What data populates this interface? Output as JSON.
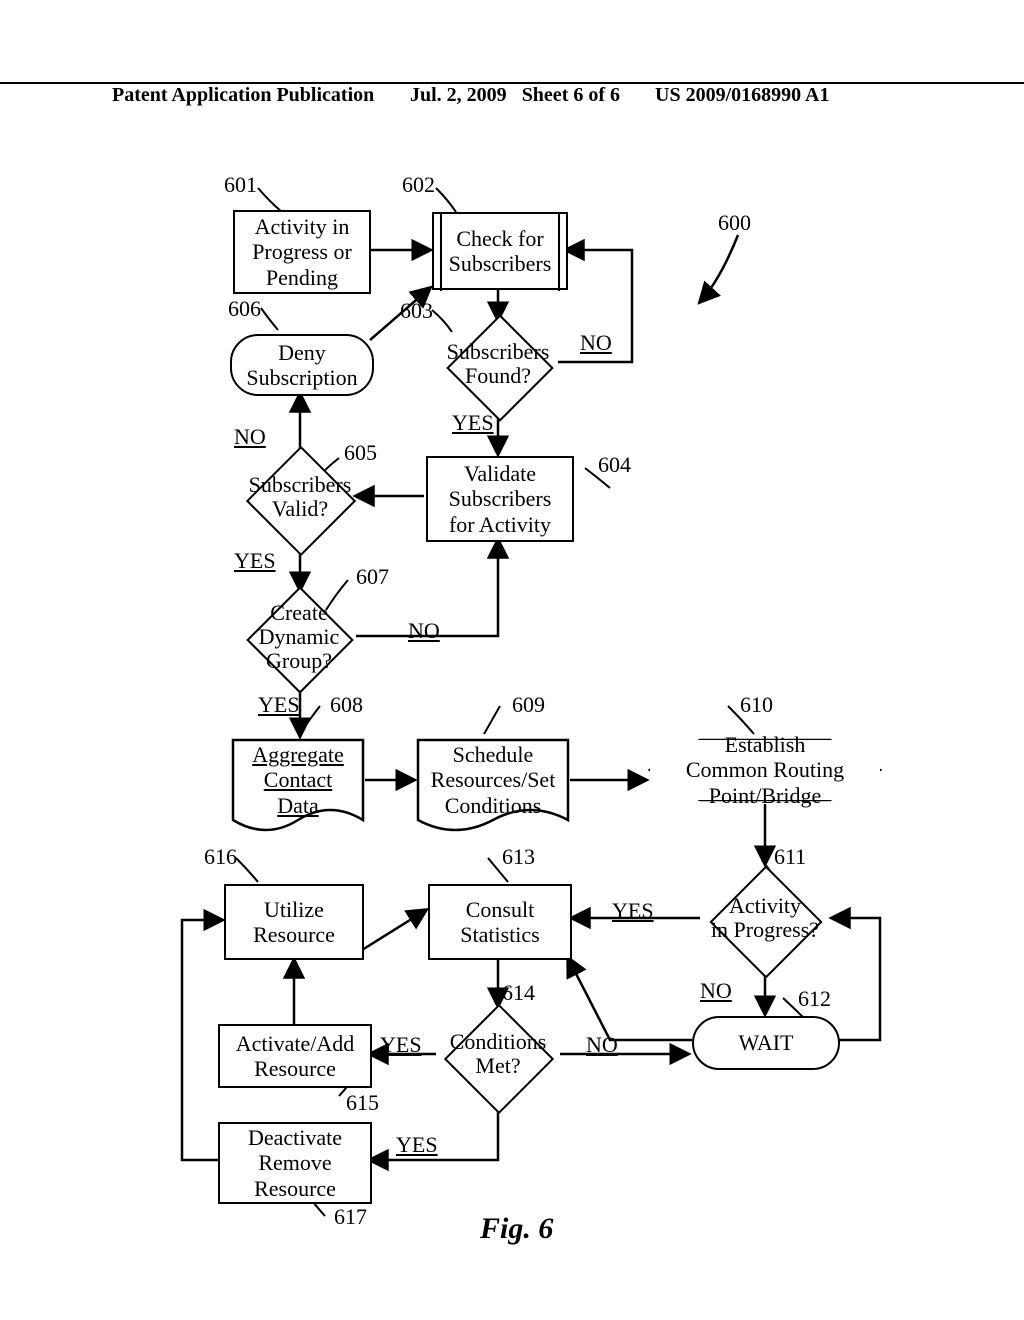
{
  "header": {
    "left": "Patent Application Publication",
    "date": "Jul. 2, 2009",
    "sheet": "Sheet 6 of 6",
    "pubno": "US 2009/0168990 A1"
  },
  "figure_ref": "600",
  "caption": "Fig. 6",
  "nodes": {
    "n601": "Activity in\nProgress or\nPending",
    "n602": "Check for\nSubscribers",
    "n603": "Subscribers\nFound?",
    "n604": "Validate\nSubscribers\nfor Activity",
    "n605": "Subscribers\nValid?",
    "n606": "Deny\nSubscription",
    "n607": "Create\nDynamic\nGroup?",
    "n608": "Aggregate\nContact\nData",
    "n609": "Schedule\nResources/Set\nConditions",
    "n610": "Establish\nCommon Routing\nPoint/Bridge",
    "n611": "Activity\nin Progress?",
    "n612": "WAIT",
    "n613": "Consult\nStatistics",
    "n614": "Conditions\nMet?",
    "n615": "Activate/Add\nResource",
    "n616": "Utilize\nResource",
    "n617": "Deactivate\nRemove\nResource"
  },
  "refs": {
    "r600": "600",
    "r601": "601",
    "r602": "602",
    "r603": "603",
    "r604": "604",
    "r605": "605",
    "r606": "606",
    "r607": "607",
    "r608": "608",
    "r609": "609",
    "r610": "610",
    "r611": "611",
    "r612": "612",
    "r613": "613",
    "r614": "614",
    "r615": "615",
    "r616": "616",
    "r617": "617"
  },
  "labels": {
    "yes": "YES",
    "no": "NO"
  }
}
